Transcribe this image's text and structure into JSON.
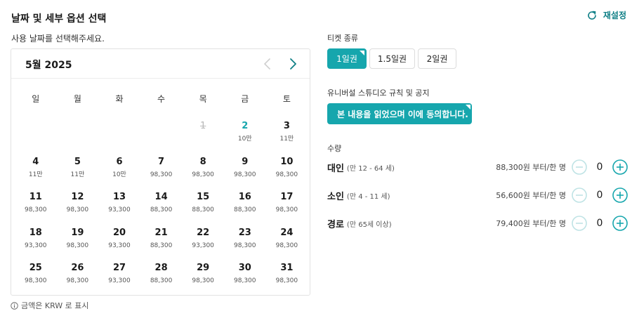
{
  "header": {
    "title": "날짜 및 세부 옵션 선택",
    "reset_label": "재설정"
  },
  "calendar": {
    "prompt": "사용 날짜를 선택해주세요.",
    "month": "5월 2025",
    "weekdays": [
      "일",
      "월",
      "화",
      "수",
      "목",
      "금",
      "토"
    ],
    "days": [
      {
        "d": "1",
        "p": "",
        "state": "disabled"
      },
      {
        "d": "2",
        "p": "10만",
        "state": "accent"
      },
      {
        "d": "3",
        "p": "11만",
        "state": ""
      },
      {
        "d": "4",
        "p": "11만",
        "state": ""
      },
      {
        "d": "5",
        "p": "11만",
        "state": ""
      },
      {
        "d": "6",
        "p": "10만",
        "state": ""
      },
      {
        "d": "7",
        "p": "98,300",
        "state": ""
      },
      {
        "d": "8",
        "p": "98,300",
        "state": ""
      },
      {
        "d": "9",
        "p": "98,300",
        "state": ""
      },
      {
        "d": "10",
        "p": "98,300",
        "state": ""
      },
      {
        "d": "11",
        "p": "98,300",
        "state": ""
      },
      {
        "d": "12",
        "p": "98,300",
        "state": ""
      },
      {
        "d": "13",
        "p": "93,300",
        "state": ""
      },
      {
        "d": "14",
        "p": "88,300",
        "state": ""
      },
      {
        "d": "15",
        "p": "88,300",
        "state": ""
      },
      {
        "d": "16",
        "p": "88,300",
        "state": ""
      },
      {
        "d": "17",
        "p": "98,300",
        "state": ""
      },
      {
        "d": "18",
        "p": "93,300",
        "state": ""
      },
      {
        "d": "19",
        "p": "98,300",
        "state": ""
      },
      {
        "d": "20",
        "p": "93,300",
        "state": ""
      },
      {
        "d": "21",
        "p": "88,300",
        "state": ""
      },
      {
        "d": "22",
        "p": "93,300",
        "state": ""
      },
      {
        "d": "23",
        "p": "98,300",
        "state": ""
      },
      {
        "d": "24",
        "p": "98,300",
        "state": ""
      },
      {
        "d": "25",
        "p": "98,300",
        "state": ""
      },
      {
        "d": "26",
        "p": "98,300",
        "state": ""
      },
      {
        "d": "27",
        "p": "93,300",
        "state": ""
      },
      {
        "d": "28",
        "p": "88,300",
        "state": ""
      },
      {
        "d": "29",
        "p": "98,300",
        "state": ""
      },
      {
        "d": "30",
        "p": "98,300",
        "state": ""
      },
      {
        "d": "31",
        "p": "98,300",
        "state": ""
      }
    ],
    "currency_note": "금액은 KRW 로 표시"
  },
  "ticket": {
    "label": "티켓 종류",
    "options": [
      {
        "label": "1일권",
        "active": true
      },
      {
        "label": "1.5일권",
        "active": false
      },
      {
        "label": "2일권",
        "active": false
      }
    ]
  },
  "rules": {
    "label": "유니버설 스튜디오 규칙 및 공지",
    "agree_label": "본 내용을 읽었으며 이에 동의합니다."
  },
  "quantity": {
    "label": "수량",
    "rows": [
      {
        "name": "대인",
        "age": "(만 12 - 64 세)",
        "price": "88,300원 부터/한 명",
        "value": "0"
      },
      {
        "name": "소인",
        "age": "(만 4 - 11 세)",
        "price": "56,600원 부터/한 명",
        "value": "0"
      },
      {
        "name": "경로",
        "age": "(만 65세 이상)",
        "price": "79,400원 부터/한 명",
        "value": "0"
      }
    ]
  },
  "colors": {
    "accent": "#16a6ad",
    "accent_dark": "#0f7f86",
    "disabled": "#b8b8b8"
  }
}
